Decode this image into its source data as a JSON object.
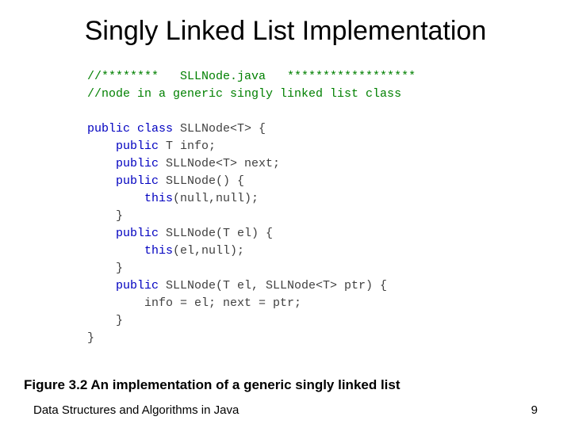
{
  "title": "Singly Linked List Implementation",
  "code": {
    "c1a": "//********   SLLNode.java   ******************",
    "c1b": "//node in a generic singly linked list class",
    "blank1": "",
    "l1_kw": "public class",
    "l1_rest": " SLLNode<T> {",
    "l2_kw": "    public",
    "l2_rest": " T info;",
    "l3_kw": "    public",
    "l3_rest": " SLLNode<T> next;",
    "l4_kw": "    public",
    "l4_rest": " SLLNode() {",
    "l5_kw": "        this",
    "l5_rest": "(null,null);",
    "l6": "    }",
    "l7_kw": "    public",
    "l7_rest": " SLLNode(T el) {",
    "l8_kw": "        this",
    "l8_rest": "(el,null);",
    "l9": "    }",
    "l10_kw": "    public",
    "l10_rest": " SLLNode(T el, SLLNode<T> ptr) {",
    "l11": "        info = el; next = ptr;",
    "l12": "    }",
    "l13": "}"
  },
  "caption": "Figure 3.2 An implementation of a generic singly linked list",
  "footer": {
    "left": "Data Structures and Algorithms in Java",
    "page": "9"
  }
}
